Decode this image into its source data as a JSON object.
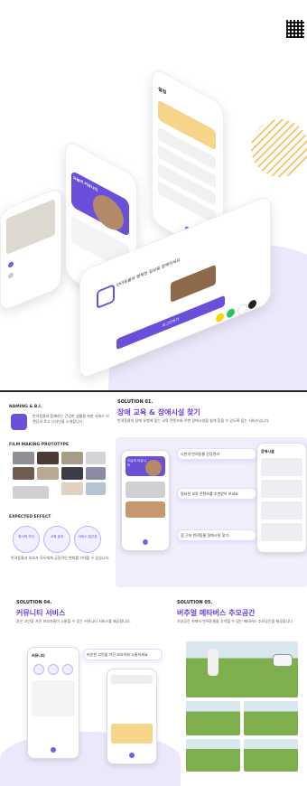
{
  "hero": {
    "front_phone_tagline": "반려동물과 행복한 일상을 함께하세요",
    "login_button": "로그인하기",
    "back_phone_header": "설정",
    "left_phone_title": "오늘의 커뮤니티"
  },
  "naming": {
    "heading": "NAMING & B.I.",
    "body": "반려동물과 함께하는 건강한 생활을 위한 서비스 브랜딩과 로고 디자인을 소개합니다."
  },
  "film": {
    "heading": "FILM MAKING PROTOTYPE"
  },
  "effect": {
    "heading": "EXPECTED EFFECT",
    "circles": [
      "정서적 지지",
      "교육 효과",
      "서비스 접근성"
    ],
    "body": "반려동물과 보호자 모두에게 긍정적인 변화를 기대할 수 있습니다."
  },
  "solution1": {
    "label": "SOLUTION 01.",
    "title": "장애 교육 & 장애시설 찾기",
    "body": "반려동물의 장애 유형에 맞는 교육 콘텐츠와 주변 장애시설을 쉽게 찾을 수 있도록 돕는 서비스입니다.",
    "callouts": [
      "나만의 반려동물 건강관리",
      "필요한 교육 콘텐츠를 추천받아 보세요",
      "집 근처 반려동물 장애시설 찾기"
    ],
    "phone1_title": "오늘의 커뮤니티",
    "phone2_title": "장애시설"
  },
  "solution4": {
    "label": "SOLUTION 04.",
    "title": "커뮤니티 서비스",
    "body": "같은 고민을 가진 보호자들이 소통할 수 있는 커뮤니티 서비스를 제공합니다.",
    "callout": "비슷한 고민을 가진 보호자와 소통하세요",
    "phone_title": "커뮤니티"
  },
  "solution5": {
    "label": "SOLUTION 05.",
    "title": "버추얼 메타버스 추모공간",
    "body": "가상공간 속에서 반려동물을 추억할 수 있는 메타버스 추모공간을 제공합니다."
  },
  "colors": {
    "accent": "#6a4fd8",
    "lavender": "#ece8fb",
    "yellow": "#f6d48a"
  }
}
